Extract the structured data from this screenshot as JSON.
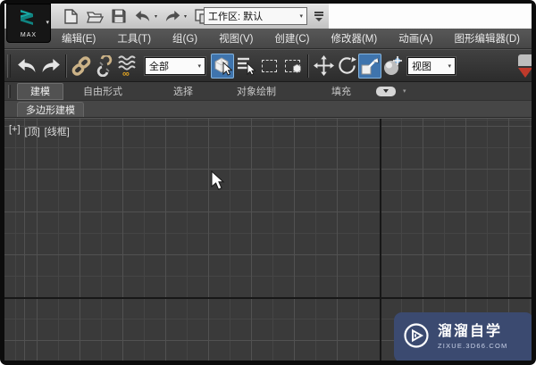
{
  "window": {
    "logo": "MAX",
    "workspace": "工作区: 默认"
  },
  "menu_bar": {
    "items": [
      {
        "label": "编辑(E)"
      },
      {
        "label": "工具(T)"
      },
      {
        "label": "组(G)"
      },
      {
        "label": "视图(V)"
      },
      {
        "label": "创建(C)"
      },
      {
        "label": "修改器(M)"
      },
      {
        "label": "动画(A)"
      },
      {
        "label": "图形编辑器(D)"
      }
    ]
  },
  "quick_access": {
    "icons": [
      "new-scene",
      "open-file",
      "save-file",
      "undo",
      "redo",
      "project-folder"
    ],
    "overflow_icon": "toolbar-overflow"
  },
  "main_toolbar": {
    "icons": [
      "undo",
      "redo",
      "select-and-link",
      "unlink-selection",
      "bind-to-space-warp",
      "select-object",
      "select-by-name",
      "rectangular-selection-region",
      "window-crossing",
      "select-and-move",
      "select-and-rotate",
      "select-and-uniform-scale",
      "select-and-manipulate",
      "snap-toggle-partial"
    ],
    "active_buttons": [
      "select-object",
      "select-and-uniform-scale"
    ],
    "selection_filter": {
      "value": "全部"
    },
    "coordinate_system": {
      "value": "视图"
    }
  },
  "ribbon": {
    "tabs": [
      {
        "label": "建模",
        "active": true
      },
      {
        "label": "自由形式",
        "active": false
      },
      {
        "label": "选择",
        "active": false
      },
      {
        "label": "对象绘制",
        "active": false
      },
      {
        "label": "填充",
        "active": false
      }
    ],
    "panel_tabs": [
      {
        "label": "多边形建模"
      }
    ]
  },
  "viewport": {
    "labels": {
      "maximize": "[+]",
      "view": "[顶]",
      "shading": "[线框]"
    }
  },
  "watermark": {
    "title": "溜溜自学",
    "subtitle": "ZIXUE.3D66.COM"
  },
  "colors": {
    "accent_blue": "#3f74ad",
    "watermark_blue": "#3b4a70",
    "gold_link": "#c9a063",
    "viewport_bg": "#3a3a3a",
    "menu_bg": "#4d4d4d"
  }
}
